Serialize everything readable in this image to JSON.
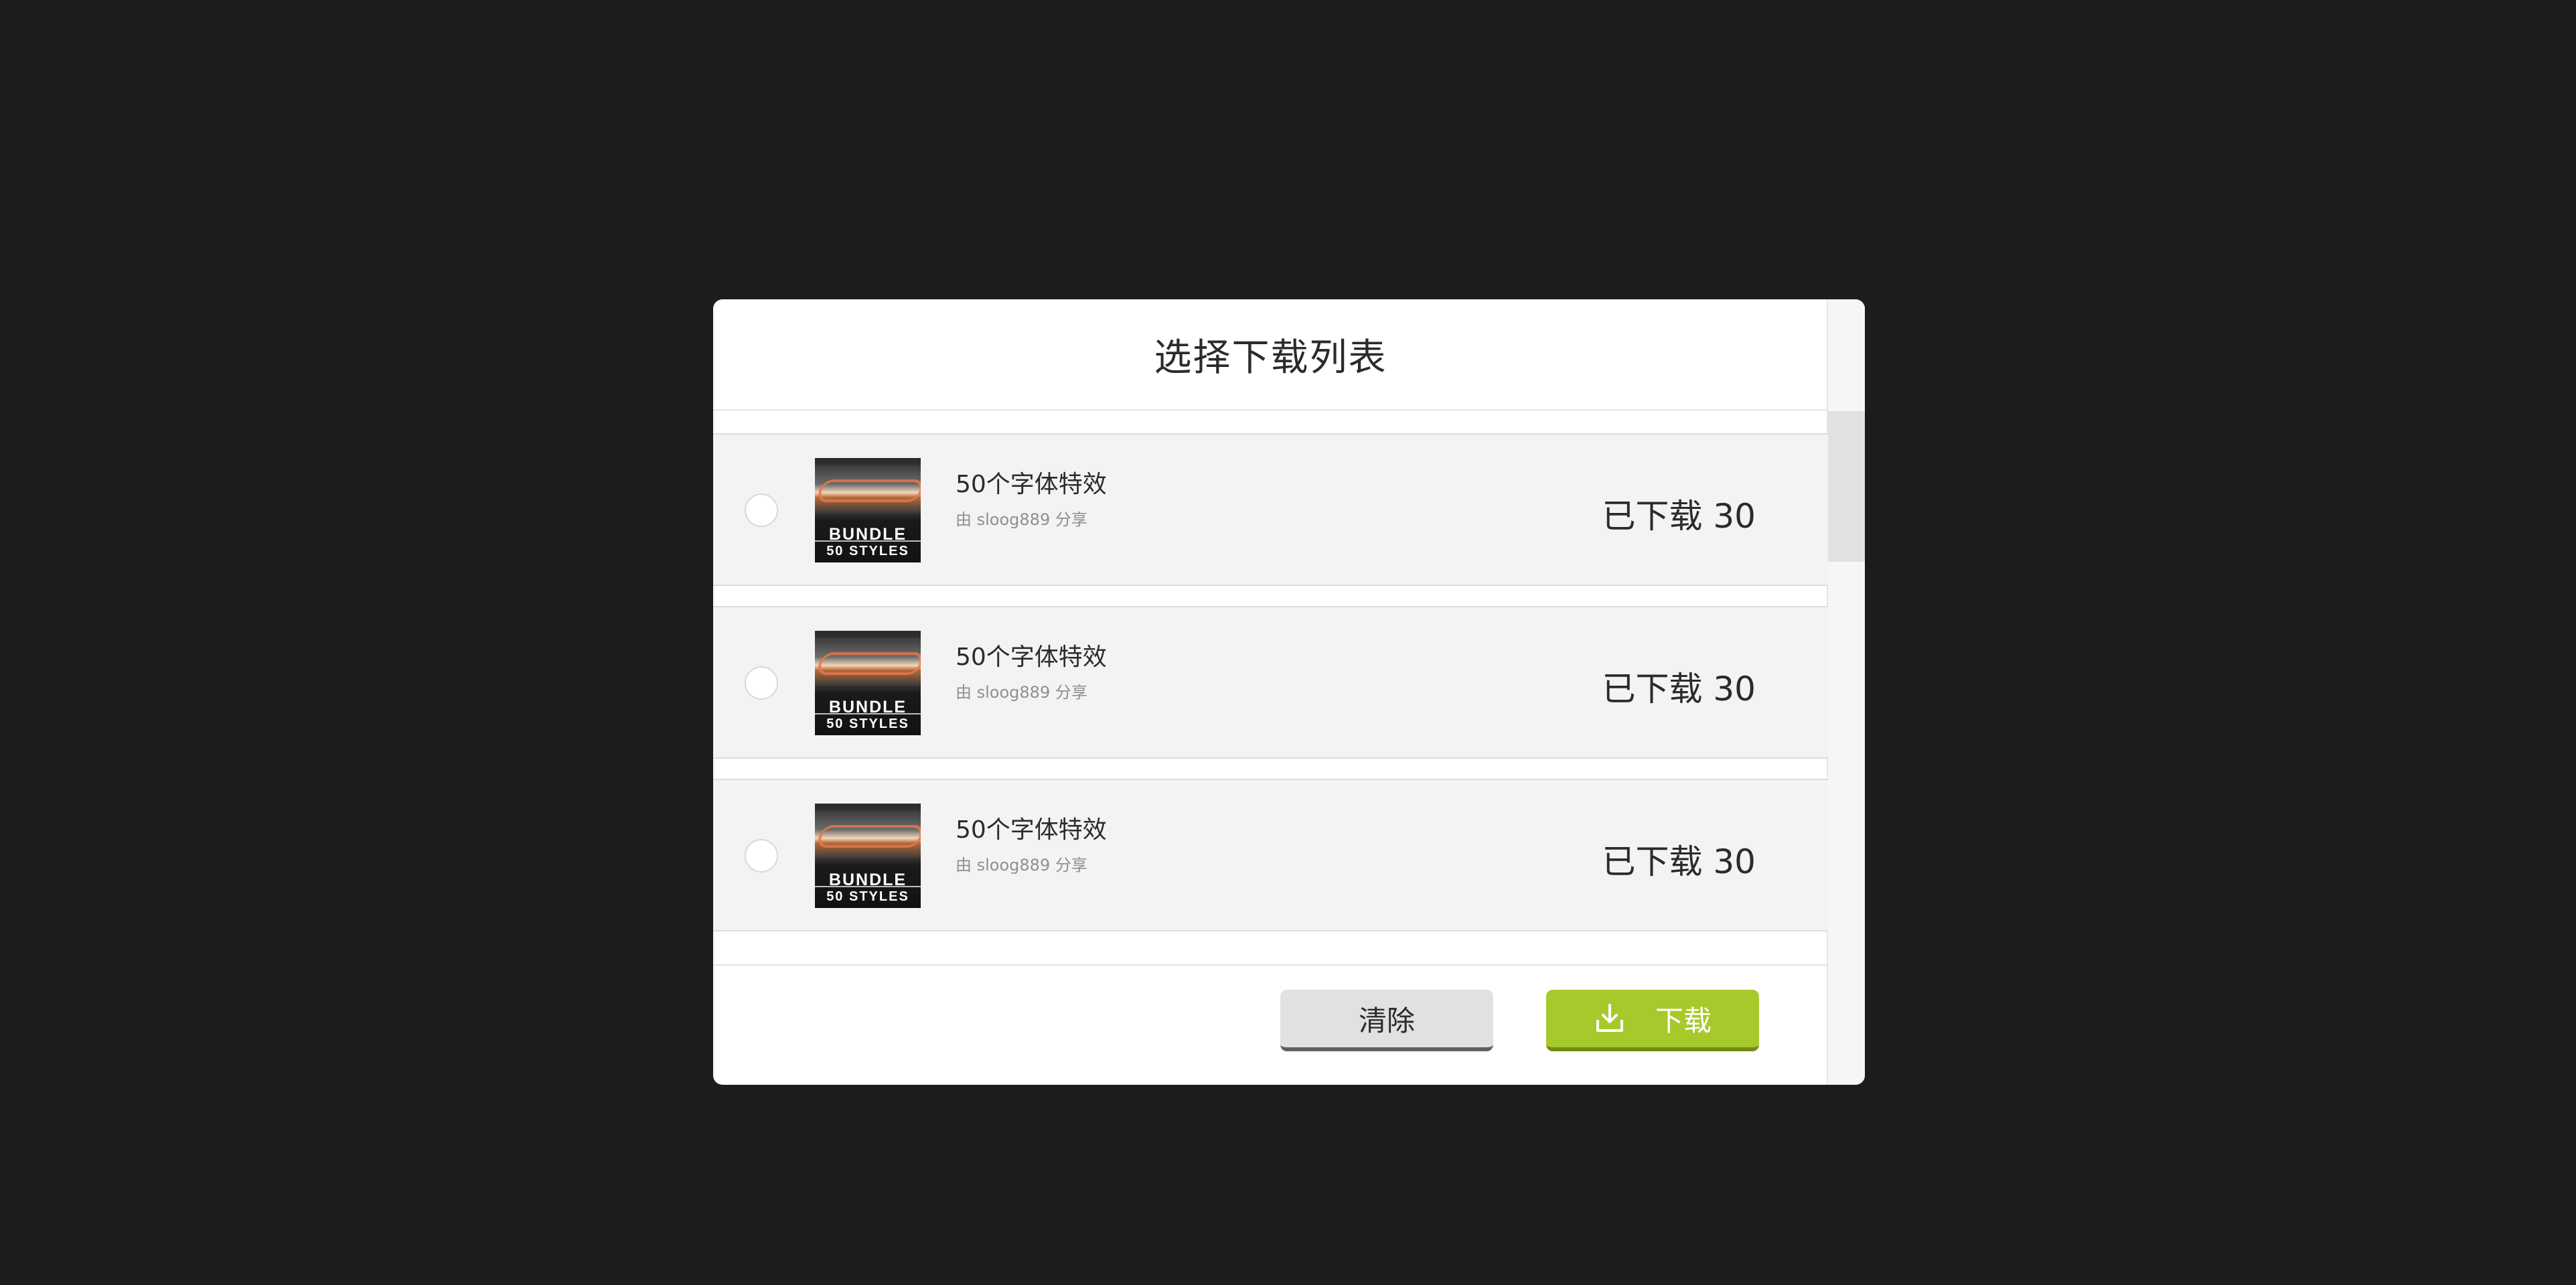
{
  "dialog": {
    "title": "选择下载列表"
  },
  "items": [
    {
      "title": "50个字体特效",
      "subtitle": "由 sloog889 分享",
      "count": "已下载 30",
      "thumb": {
        "line1": "BUNDLE",
        "line2": "50 STYLES"
      }
    },
    {
      "title": "50个字体特效",
      "subtitle": "由 sloog889 分享",
      "count": "已下载 30",
      "thumb": {
        "line1": "BUNDLE",
        "line2": "50 STYLES"
      }
    },
    {
      "title": "50个字体特效",
      "subtitle": "由 sloog889 分享",
      "count": "已下载 30",
      "thumb": {
        "line1": "BUNDLE",
        "line2": "50 STYLES"
      }
    }
  ],
  "footer": {
    "clear_label": "清除",
    "download_label": "下载",
    "download_icon": "download-tray-icon"
  },
  "colors": {
    "background": "#1c1c1c",
    "download_button": "#a8c92c",
    "clear_button": "#e1e1e1"
  }
}
